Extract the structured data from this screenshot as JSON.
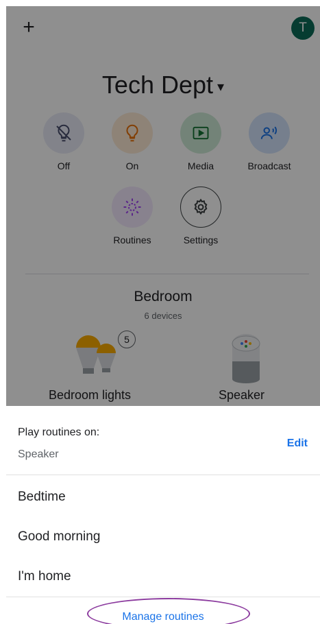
{
  "header": {
    "add_symbol": "+",
    "avatar_initial": "T",
    "home_name": "Tech Dept",
    "home_caret": "▾"
  },
  "chips": [
    {
      "label": "Off",
      "icon": "bulb-off-icon",
      "color": "#4a4f6f"
    },
    {
      "label": "On",
      "icon": "bulb-on-icon",
      "color": "#e8710a"
    },
    {
      "label": "Media",
      "icon": "play-icon",
      "color": "#137333"
    },
    {
      "label": "Broadcast",
      "icon": "broadcast-icon",
      "color": "#1a73e8"
    },
    {
      "label": "Routines",
      "icon": "routines-icon",
      "color": "#a142f4"
    },
    {
      "label": "Settings",
      "icon": "gear-icon",
      "color": "#3c4043"
    }
  ],
  "room": {
    "name": "Bedroom",
    "device_count": "6 devices",
    "devices": [
      {
        "label": "Bedroom lights",
        "badge": "5"
      },
      {
        "label": "Speaker"
      }
    ]
  },
  "sheet": {
    "title": "Play routines on:",
    "speaker": "Speaker",
    "edit_label": "Edit",
    "routines": [
      "Bedtime",
      "Good morning",
      "I'm home"
    ],
    "manage_label": "Manage routines"
  },
  "colors": {
    "accent": "#1a73e8",
    "avatar": "#0c6b58",
    "highlight_ellipse": "#8b3a9e"
  }
}
